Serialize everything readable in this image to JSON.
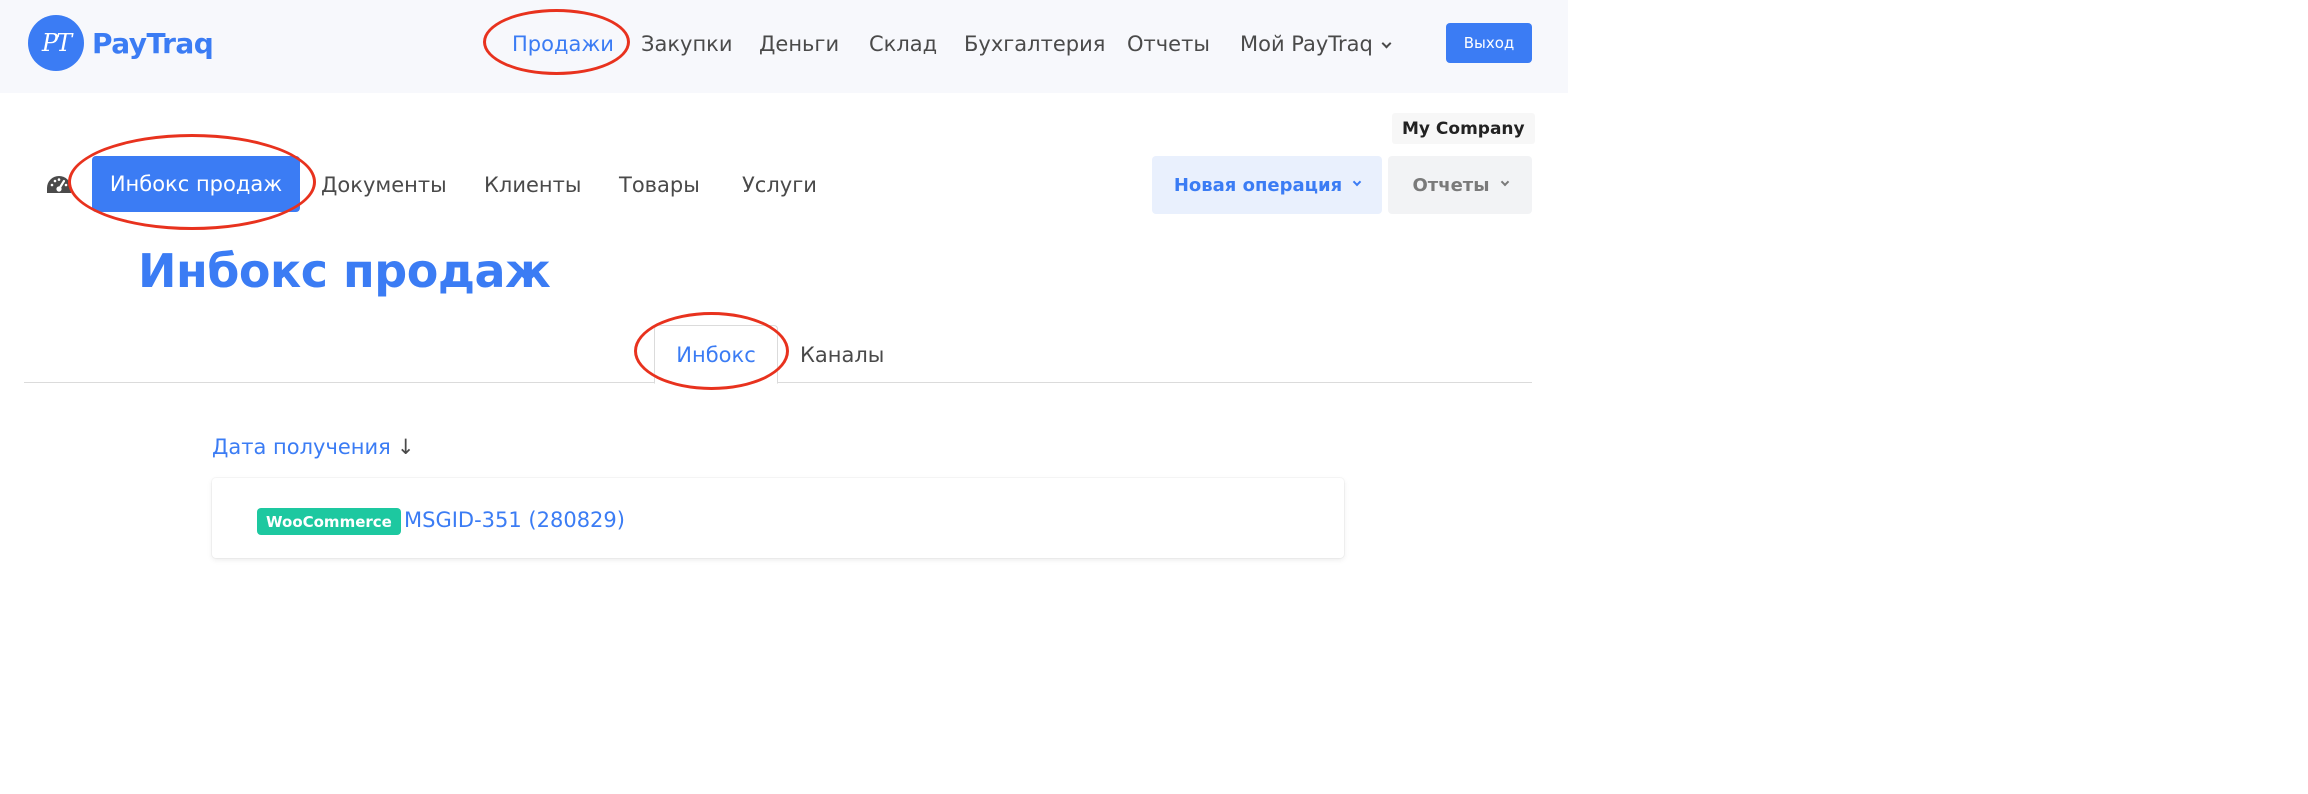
{
  "brand": {
    "logo_mark": "PT",
    "name": "PayTraq",
    "accent": "#3b7cf4"
  },
  "topnav": {
    "items": [
      {
        "label": "Продажи",
        "active": true
      },
      {
        "label": "Закупки"
      },
      {
        "label": "Деньги"
      },
      {
        "label": "Склад"
      },
      {
        "label": "Бухгалтерия"
      },
      {
        "label": "Отчеты"
      },
      {
        "label": "Мой PayTraq",
        "dropdown": true
      }
    ],
    "logout_label": "Выход"
  },
  "company": "My Company",
  "subnav": {
    "dashboard_icon": "speedometer-icon",
    "items": [
      {
        "label": "Инбокс продаж",
        "active": true
      },
      {
        "label": "Документы"
      },
      {
        "label": "Клиенты"
      },
      {
        "label": "Товары"
      },
      {
        "label": "Услуги"
      }
    ],
    "new_operation_label": "Новая операция",
    "reports_label": "Отчеты"
  },
  "page_title": "Инбокс продаж",
  "tabs": [
    {
      "label": "Инбокс",
      "active": true
    },
    {
      "label": "Каналы"
    }
  ],
  "sort": {
    "label": "Дата получения",
    "arrow": "↓"
  },
  "inbox": [
    {
      "tag": "WooCommerce",
      "tag_color": "#1dc8a0",
      "title": "MSGID-351 (280829)"
    }
  ],
  "annotation_color": "#e8321e"
}
